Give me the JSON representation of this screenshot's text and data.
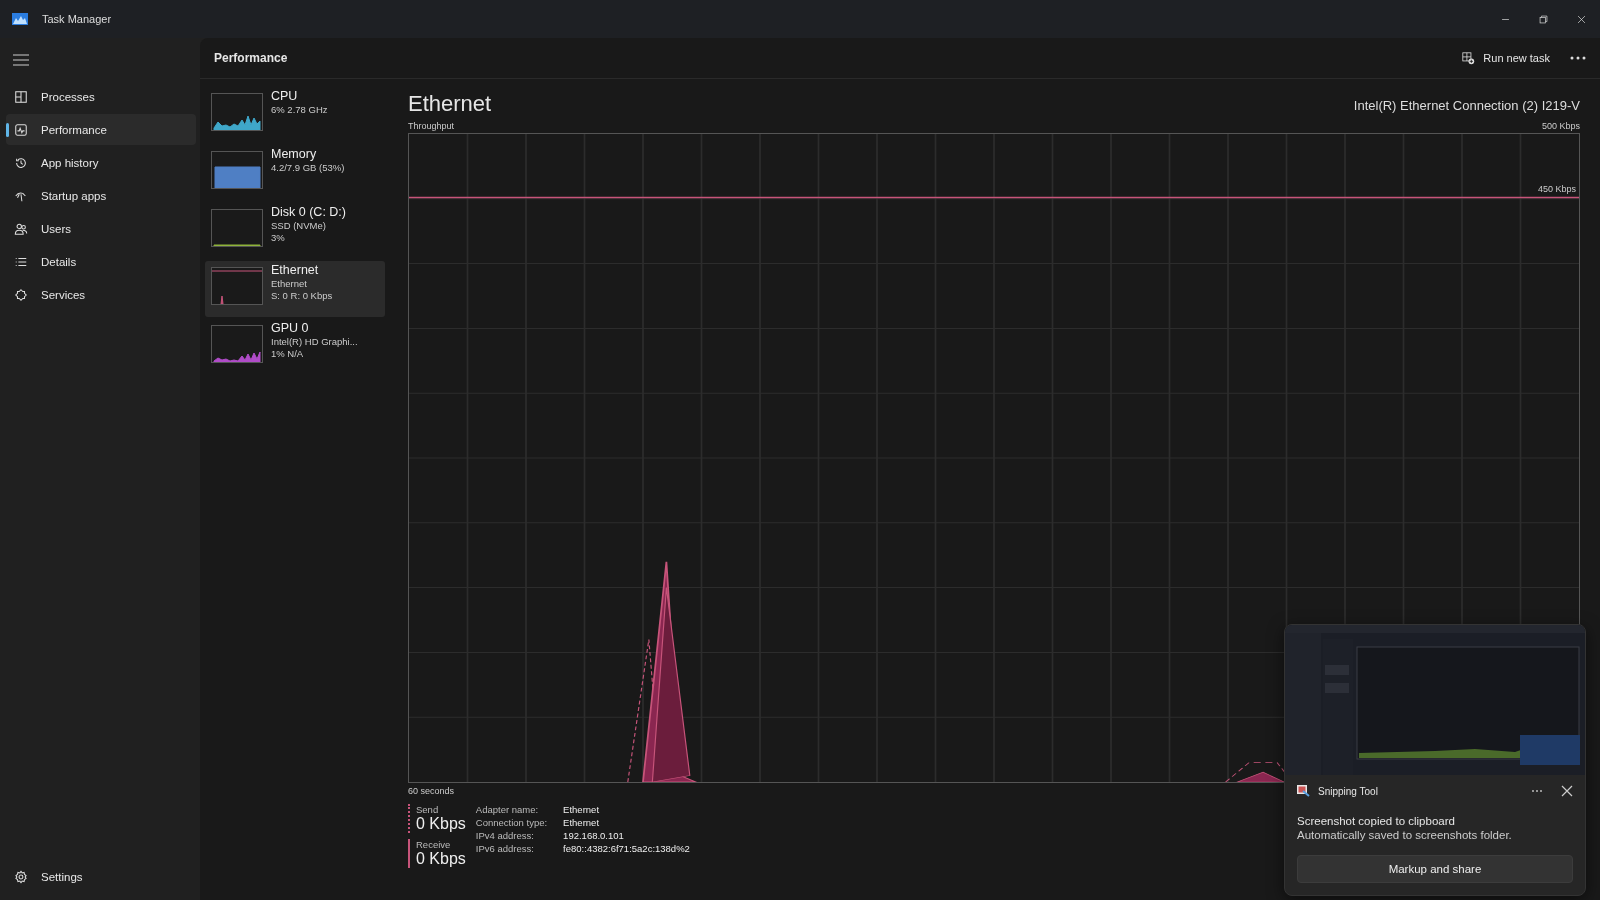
{
  "window": {
    "title": "Task Manager"
  },
  "sidebar": {
    "items": [
      {
        "label": "Processes",
        "selected": false
      },
      {
        "label": "Performance",
        "selected": true
      },
      {
        "label": "App history",
        "selected": false
      },
      {
        "label": "Startup apps",
        "selected": false
      },
      {
        "label": "Users",
        "selected": false
      },
      {
        "label": "Details",
        "selected": false
      },
      {
        "label": "Services",
        "selected": false
      }
    ],
    "settings": {
      "label": "Settings"
    }
  },
  "header": {
    "title": "Performance",
    "run_button": "Run new task"
  },
  "resources": [
    {
      "name": "CPU",
      "lines": [
        "6% 2.78 GHz"
      ],
      "color": "#3fa7c9",
      "selected": false
    },
    {
      "name": "Memory",
      "lines": [
        "4.2/7.9 GB (53%)"
      ],
      "color": "#4f7fc4",
      "selected": false
    },
    {
      "name": "Disk 0 (C: D:)",
      "lines": [
        "SSD (NVMe)",
        "3%"
      ],
      "color": "#8fb33a",
      "selected": false
    },
    {
      "name": "Ethernet",
      "lines": [
        "Ethernet",
        "S: 0 R: 0 Kbps"
      ],
      "color": "#c7547a",
      "selected": true
    },
    {
      "name": "GPU 0",
      "lines": [
        "Intel(R) HD Graphi...",
        "1% N/A"
      ],
      "color": "#b04cc8",
      "selected": false
    }
  ],
  "detail": {
    "title": "Ethernet",
    "adapter": "Intel(R) Ethernet Connection (2) I219-V",
    "graph_label": "Throughput",
    "max_label": "500 Kbps",
    "line_label": "450 Kbps",
    "time_label": "60 seconds",
    "send": {
      "label": "Send",
      "value": "0 Kbps"
    },
    "receive": {
      "label": "Receive",
      "value": "0 Kbps"
    },
    "properties": [
      {
        "label": "Adapter name:",
        "value": "Ethernet"
      },
      {
        "label": "Connection type:",
        "value": "Ethernet"
      },
      {
        "label": "IPv4 address:",
        "value": "192.168.0.101"
      },
      {
        "label": "IPv6 address:",
        "value": "fe80::4382:6f71:5a2c:138d%2"
      }
    ]
  },
  "notification": {
    "app": "Snipping Tool",
    "title": "Screenshot copied to clipboard",
    "body": "Automatically saved to screenshots folder.",
    "action": "Markup and share"
  }
}
